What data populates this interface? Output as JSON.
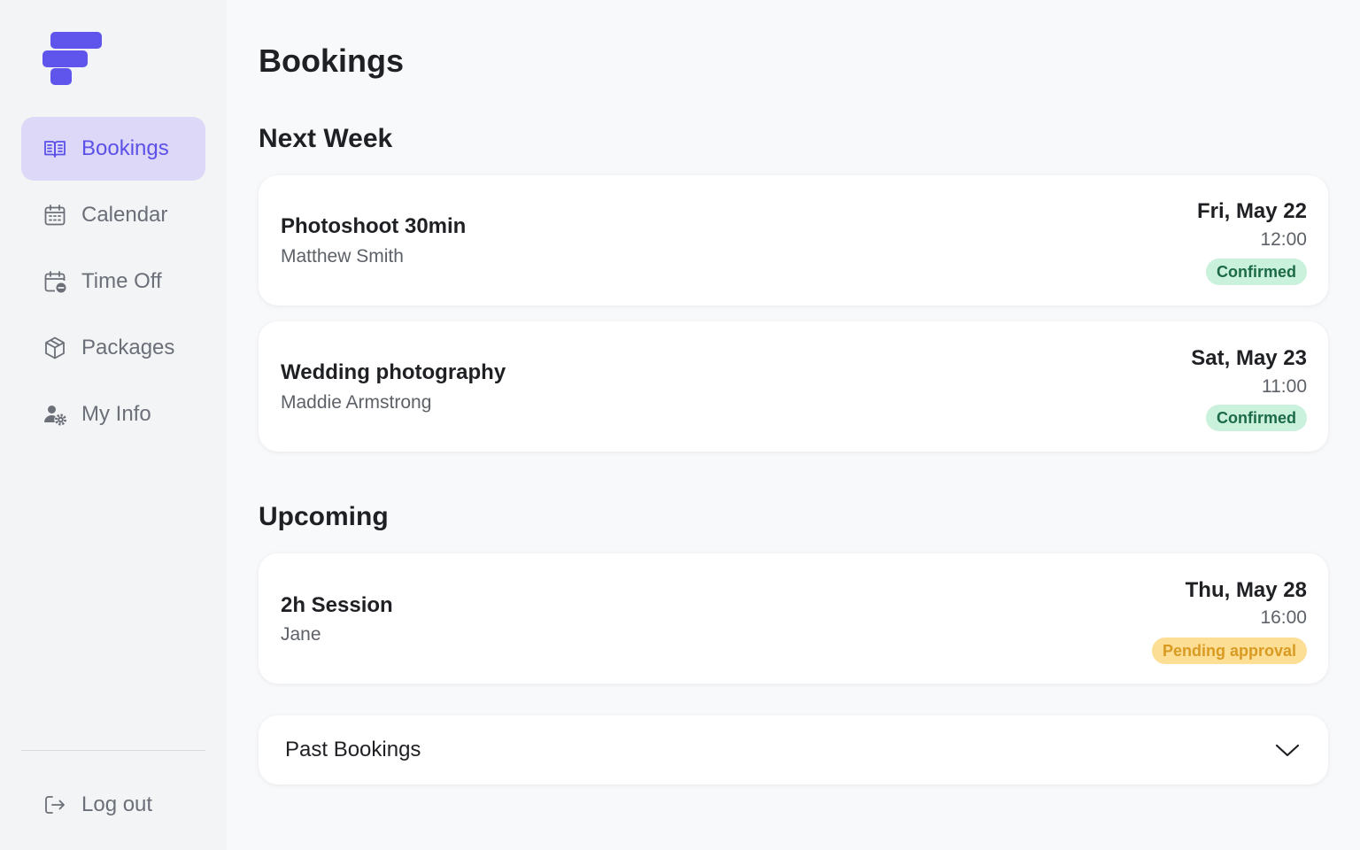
{
  "sidebar": {
    "items": [
      {
        "label": "Bookings",
        "icon": "book-open-icon",
        "active": true
      },
      {
        "label": "Calendar",
        "icon": "calendar-icon"
      },
      {
        "label": "Time Off",
        "icon": "calendar-minus-icon"
      },
      {
        "label": "Packages",
        "icon": "package-icon"
      },
      {
        "label": "My Info",
        "icon": "user-gear-icon"
      }
    ],
    "logout_label": "Log out"
  },
  "page": {
    "title": "Bookings"
  },
  "sections": {
    "next_week": {
      "title": "Next Week",
      "bookings": [
        {
          "title": "Photoshoot 30min",
          "client": "Matthew Smith",
          "date": "Fri, May 22",
          "time": "12:00",
          "status": "Confirmed"
        },
        {
          "title": "Wedding photography",
          "client": "Maddie Armstrong",
          "date": "Sat, May 23",
          "time": "11:00",
          "status": "Confirmed"
        }
      ]
    },
    "upcoming": {
      "title": "Upcoming",
      "bookings": [
        {
          "title": "2h Session",
          "client": "Jane",
          "date": "Thu, May 28",
          "time": "16:00",
          "status": "Pending approval"
        }
      ]
    }
  },
  "past_bookings": {
    "label": "Past Bookings"
  },
  "colors": {
    "accent": "#5f55ec",
    "active_bg": "#ddd8f7",
    "confirmed_bg": "#c9f1dc",
    "confirmed_text": "#1c6b46",
    "pending_bg": "#fcdf94",
    "pending_text": "#d99a22"
  }
}
